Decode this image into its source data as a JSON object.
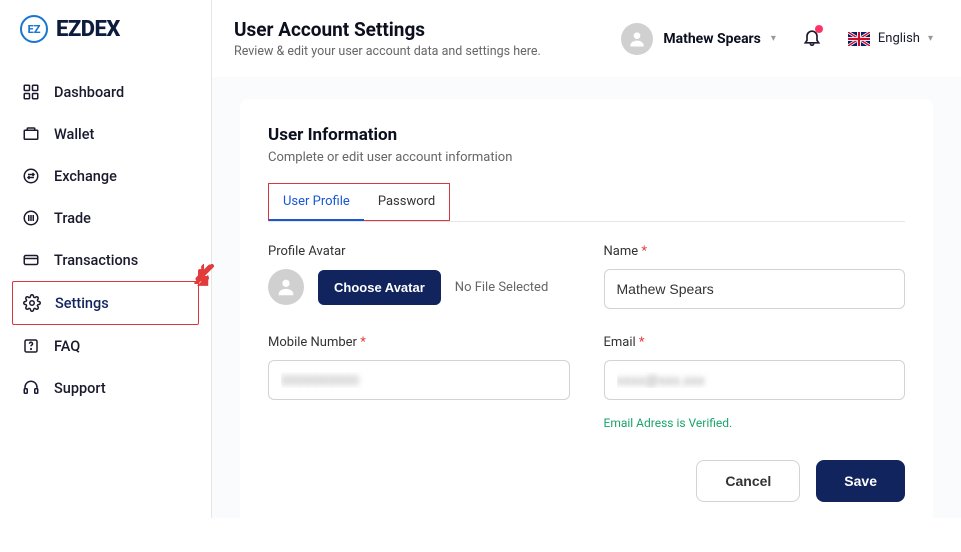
{
  "brand": {
    "mark": "EZ",
    "name": "EZDEX"
  },
  "sidebar": {
    "items": [
      {
        "label": "Dashboard"
      },
      {
        "label": "Wallet"
      },
      {
        "label": "Exchange"
      },
      {
        "label": "Trade"
      },
      {
        "label": "Transactions"
      },
      {
        "label": "Settings"
      },
      {
        "label": "FAQ"
      },
      {
        "label": "Support"
      }
    ]
  },
  "header": {
    "title": "User Account Settings",
    "subtitle": "Review & edit your user account data and settings here.",
    "user_name": "Mathew Spears",
    "lang_label": "English"
  },
  "card": {
    "title": "User Information",
    "subtitle": "Complete or edit user account information",
    "tabs": [
      {
        "label": "User Profile"
      },
      {
        "label": "Password"
      }
    ]
  },
  "form": {
    "avatar_label": "Profile Avatar",
    "choose_avatar": "Choose Avatar",
    "file_status": "No File Selected",
    "name_label": "Name",
    "name_value": "Mathew Spears",
    "mobile_label": "Mobile Number",
    "mobile_value": "0000000000",
    "email_label": "Email",
    "email_value": "xxxx@xxx.xxx",
    "email_verified": "Email Adress is Verified.",
    "cancel": "Cancel",
    "save": "Save"
  }
}
